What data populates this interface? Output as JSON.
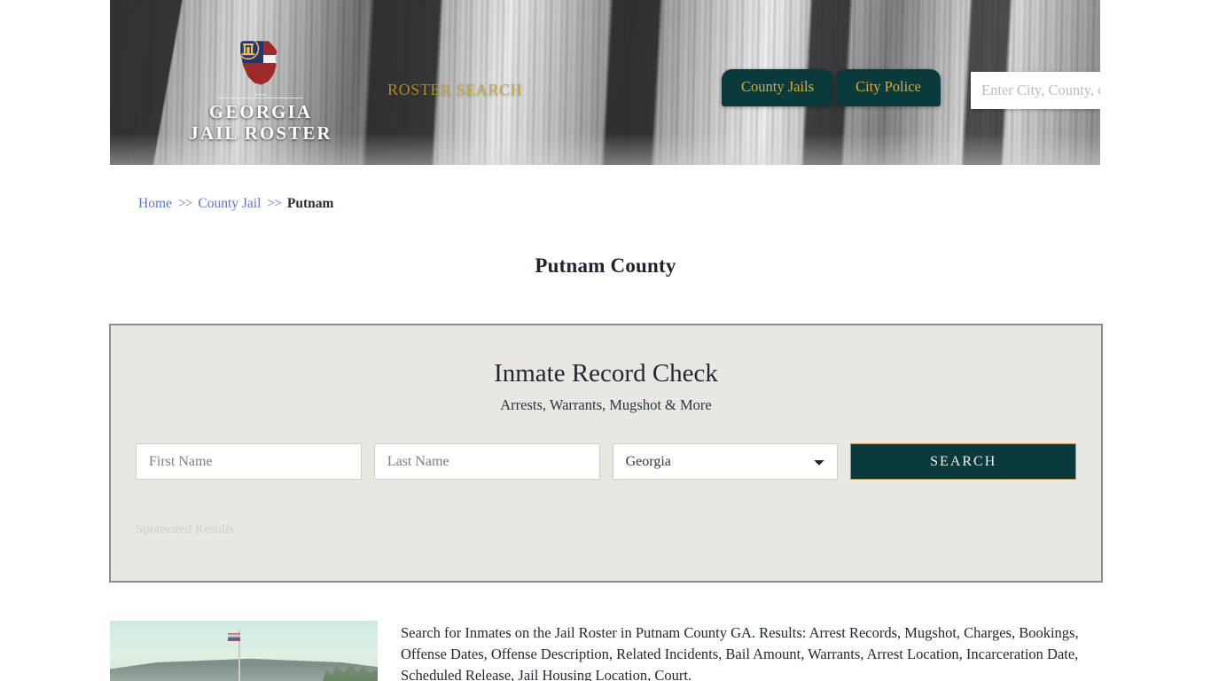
{
  "site": {
    "logo_line1": "GEORGIA",
    "logo_line2": "JAIL ROSTER",
    "tagline": "ROSTER SEARCH"
  },
  "header": {
    "nav": [
      {
        "label": "County Jails"
      },
      {
        "label": "City Police"
      }
    ],
    "search": {
      "placeholder": "Enter City, County, or Facil",
      "value": "",
      "icon": "search-icon"
    }
  },
  "breadcrumb": {
    "home": "Home",
    "sep1": ">>",
    "county_jail": "County Jail",
    "sep2": ">>",
    "current": "Putnam"
  },
  "page": {
    "title": "Putnam County"
  },
  "inmate_card": {
    "title": "Inmate Record Check",
    "subtitle": "Arrests, Warrants, Mugshot & More",
    "first_name_placeholder": "First Name",
    "first_name_value": "",
    "last_name_placeholder": "Last Name",
    "last_name_value": "",
    "state_selected": "Georgia",
    "state_options": [
      "Georgia"
    ],
    "search_button": "SEARCH",
    "sponsored_label": "Sponsored Results"
  },
  "bottom": {
    "photo_alt": "putnam-county-jail-photo",
    "description": "Search for Inmates on the Jail Roster in Putnam County GA. Results: Arrest Records, Mugshot, Charges, Bookings, Offense Dates, Offense Description, Related Incidents, Bail Amount, Warrants, Arrest Location, Incarceration Date, Scheduled Release, Jail Housing Location, Court."
  },
  "colors": {
    "brand_teal": "#0b3a3c",
    "brand_gold": "#d4af37",
    "link_blue": "#5b74d6",
    "card_bg": "#e9e7e2",
    "card_border": "#8d8d8d"
  }
}
